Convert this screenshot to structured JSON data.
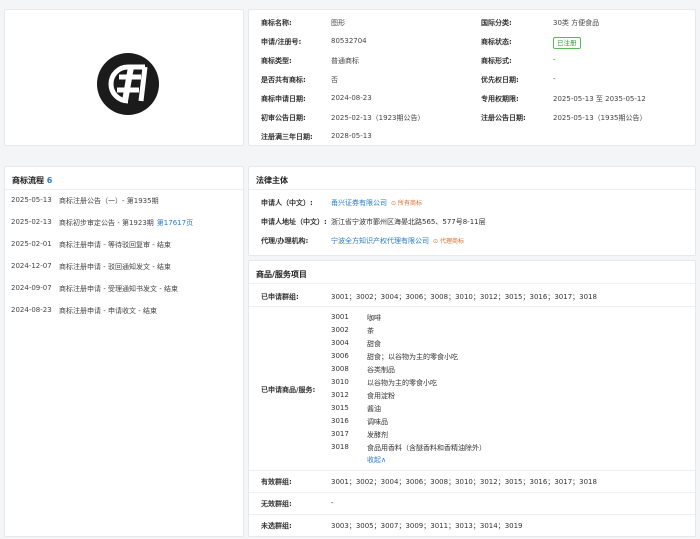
{
  "trademark": {
    "rows": [
      {
        "l1": "商标名称:",
        "v1": "图形",
        "l2": "国际分类:",
        "v2": "30类 方便食品"
      },
      {
        "l1": "申请/注册号:",
        "v1": "80532704",
        "l2": "商标状态:",
        "v2": "已注册"
      },
      {
        "l1": "商标类型:",
        "v1": "普通商标",
        "l2": "商标形式:",
        "v2": "-"
      },
      {
        "l1": "是否共有商标:",
        "v1": "否",
        "l2": "优先权日期:",
        "v2": "-"
      },
      {
        "l1": "商标申请日期:",
        "v1": "2024-08-23",
        "l2": "专用权期限:",
        "v2": "2025-05-13 至 2035-05-12"
      },
      {
        "l1": "初审公告日期:",
        "v1": "2025-02-13（1923期公告）",
        "l2": "注册公告日期:",
        "v2": "2025-05-13（1935期公告）"
      },
      {
        "l1": "注册满三年日期:",
        "v1": "2028-05-13",
        "l2": "",
        "v2": ""
      }
    ],
    "logo_text": "主"
  },
  "flow": {
    "title": "商标流程",
    "count": "6",
    "items": [
      {
        "date": "2025-05-13",
        "text": "商标注册公告（一）- 第1935期",
        "extra": ""
      },
      {
        "date": "2025-02-13",
        "text": "商标初步审定公告 - 第1923期",
        "extra": "第17617页"
      },
      {
        "date": "2025-02-01",
        "text": "商标注册申请 - 等待驳回复审 - 结束",
        "extra": ""
      },
      {
        "date": "2024-12-07",
        "text": "商标注册申请 - 驳回通知发文 - 结束",
        "extra": ""
      },
      {
        "date": "2024-09-07",
        "text": "商标注册申请 - 受理通知书发文 - 结束",
        "extra": ""
      },
      {
        "date": "2024-08-23",
        "text": "商标注册申请 - 申请收文 - 结束",
        "extra": ""
      }
    ]
  },
  "legal": {
    "title": "法律主体",
    "applicant_label": "申请人（中文）:",
    "applicant": "甬兴证券有限公司",
    "applicant_tag": "所有商标",
    "address_label": "申请人地址（中文）:",
    "address": "浙江省宁波市鄞州区海晏北路565、577号8-11层",
    "agent_label": "代理/办理机构:",
    "agent": "宁波全方知识产权代理有限公司",
    "agent_tag": "代理商标"
  },
  "goods": {
    "title": "商品/服务项目",
    "applied_groups_label": "已申请群组:",
    "applied_groups": "3001；3002；3004；3006；3008；3010；3012；3015；3016；3017；3018",
    "items_label": "已申请商品/服务:",
    "items": [
      {
        "code": "3001",
        "name": "咖啡"
      },
      {
        "code": "3002",
        "name": "茶"
      },
      {
        "code": "3004",
        "name": "甜食"
      },
      {
        "code": "3006",
        "name": "甜食；以谷物为主的零食小吃"
      },
      {
        "code": "3008",
        "name": "谷类制品"
      },
      {
        "code": "3010",
        "name": "以谷物为主的零食小吃"
      },
      {
        "code": "3012",
        "name": "食用淀粉"
      },
      {
        "code": "3015",
        "name": "酱油"
      },
      {
        "code": "3016",
        "name": "调味品"
      },
      {
        "code": "3017",
        "name": "发酵剂"
      },
      {
        "code": "3018",
        "name": "食品用香料（含醚香料和香精油除外）"
      }
    ],
    "collapse": "收起∧",
    "valid_label": "有效群组:",
    "valid": "3001；3002；3004；3006；3008；3010；3012；3015；3016；3017；3018",
    "invalid_label": "无效群组:",
    "invalid": "-",
    "unselected_label": "未选群组:",
    "unselected": "3003；3005；3007；3009；3011；3013；3014；3019"
  }
}
